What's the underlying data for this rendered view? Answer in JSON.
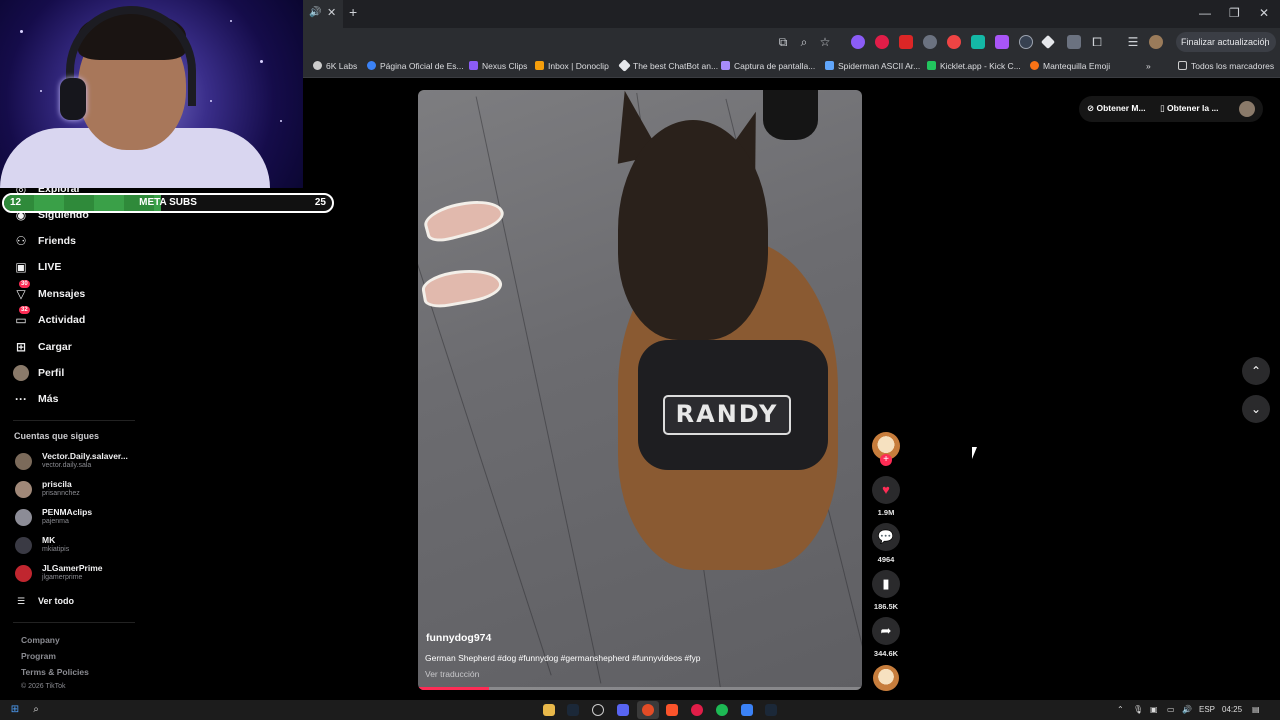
{
  "browser": {
    "new_tab_symbol": "+",
    "finalize_update_label": "Finalizar actualización",
    "more_symbol": "⋮",
    "bookmarks": [
      "6K Labs",
      "Página Oficial de Es...",
      "Nexus Clips",
      "Inbox | Donoclip",
      "The best ChatBot an...",
      "Captura de pantalla...",
      "Spiderman ASCII Ar...",
      "Kicklet.app - Kick C...",
      "Mantequilla Emoji"
    ],
    "bookmarks_overflow": "»",
    "all_bookmarks_label": "Todos los marcadores"
  },
  "overlay": {
    "meta_label": "META SUBS",
    "meta_current": "12",
    "meta_goal": "25",
    "meta_progress": 0.48
  },
  "sidebar": {
    "nav": {
      "explorar": "Explorar",
      "siguiendo": "Siguiendo",
      "friends": "Friends",
      "live": "LIVE",
      "mensajes": "Mensajes",
      "mensajes_badge": "30",
      "actividad": "Actividad",
      "actividad_badge": "32",
      "cargar": "Cargar",
      "perfil": "Perfil",
      "mas": "Más"
    },
    "following_title": "Cuentas que sigues",
    "accounts": [
      {
        "name": "Vector.Daily.salaver...",
        "handle": "vector.daily.sala"
      },
      {
        "name": "priscila",
        "handle": "prisannchez"
      },
      {
        "name": "PENMAclips",
        "handle": "pajenma"
      },
      {
        "name": "MK",
        "handle": "mkiatipis"
      },
      {
        "name": "JLGamerPrime",
        "handle": "jlgamerprime"
      }
    ],
    "see_all": "Ver todo",
    "footer": {
      "company": "Company",
      "program": "Program",
      "terms": "Terms & Policies",
      "copyright": "© 2026 TikTok"
    }
  },
  "top_buttons": {
    "get_app": "Obtener M...",
    "get_desktop": "Obtener la ..."
  },
  "video": {
    "patch_text": "RANDY",
    "username": "funnydog974",
    "description": "German Shepherd #dog #funnydog #germanshepherd #funnyvideos #fyp",
    "translate": "Ver traducción",
    "progress": 0.16
  },
  "actions": {
    "likes": "1.9M",
    "comments": "4964",
    "saves": "186.5K",
    "shares": "344.6K"
  },
  "taskbar": {
    "lang": "ESP",
    "time": "04:25"
  },
  "colors": {
    "accent": "#fe2c55",
    "meta_fill": "#3aa048",
    "chrome_bg": "#2b2d31"
  }
}
